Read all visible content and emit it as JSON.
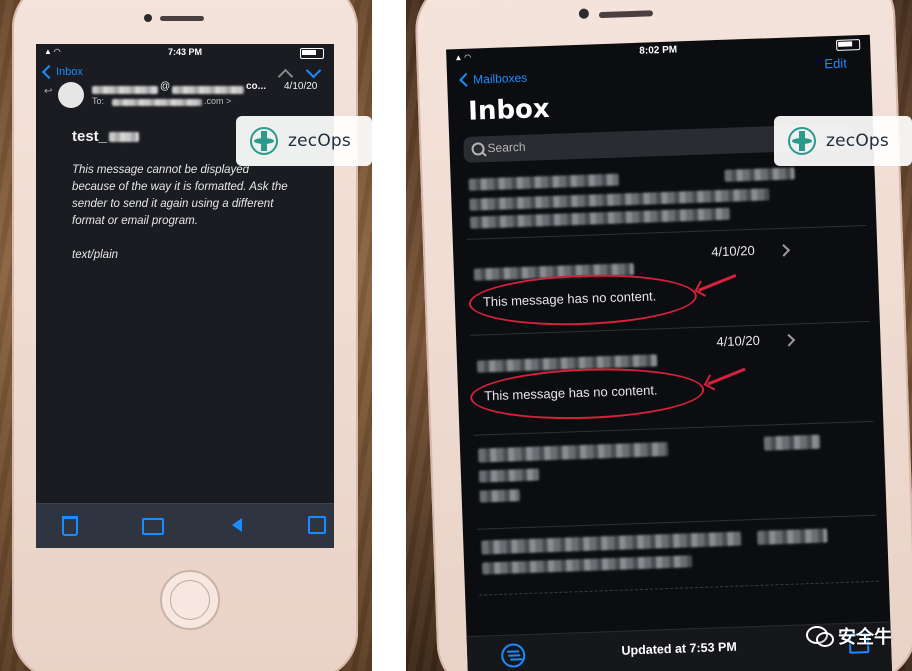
{
  "left_photo": {
    "status_time": "7:43 PM",
    "nav_back_label": "Inbox",
    "message_date": "4/10/20",
    "from_suffix": "co...",
    "to_prefix": "To:",
    "to_suffix": ".com >",
    "subject": "test_",
    "body_line1": "This message cannot be displayed",
    "body_line2": "because of the way it is formatted. Ask the",
    "body_line3": "sender to send it again using a different",
    "body_line4": "format or email program.",
    "mime_type": "text/plain",
    "toolbar_icons": [
      "trash-icon",
      "folder-icon",
      "reply-icon",
      "compose-icon"
    ],
    "accent_color": "#1a8cff"
  },
  "right_photo": {
    "status_time": "8:02 PM",
    "nav_back_label": "Mailboxes",
    "edit_label": "Edit",
    "title": "Inbox",
    "search_placeholder": "Search",
    "rows": [
      {
        "date": "4/10/20",
        "preview": "This message has no content."
      },
      {
        "date": "4/10/20",
        "preview": "This message has no content."
      }
    ],
    "updated_text": "Updated at 7:53 PM",
    "annotation_color": "#d6213c"
  },
  "logo": {
    "brand_text": "zecOps"
  },
  "watermark": {
    "text": "安全牛"
  }
}
